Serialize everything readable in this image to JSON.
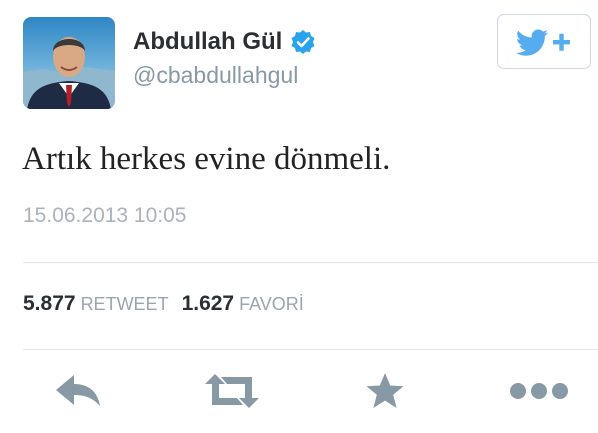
{
  "user": {
    "display_name": "Abdullah Gül",
    "handle": "@cbabdullahgul",
    "verified": true
  },
  "tweet": {
    "text": "Artık herkes evine dönmeli.",
    "timestamp": "15.06.2013 10:05"
  },
  "stats": {
    "retweets_count": "5.877",
    "retweets_label": "RETWEET",
    "favorites_count": "1.627",
    "favorites_label": "FAVORİ"
  },
  "icons": {
    "follow": "follow-bird-plus-icon",
    "reply": "reply-icon",
    "retweet": "retweet-icon",
    "favorite": "star-icon",
    "more": "more-dots-icon"
  },
  "colors": {
    "twitter_blue": "#55acee",
    "action_gray": "#8899a6",
    "text_dark": "#292f33",
    "muted": "#a8b3bc"
  }
}
